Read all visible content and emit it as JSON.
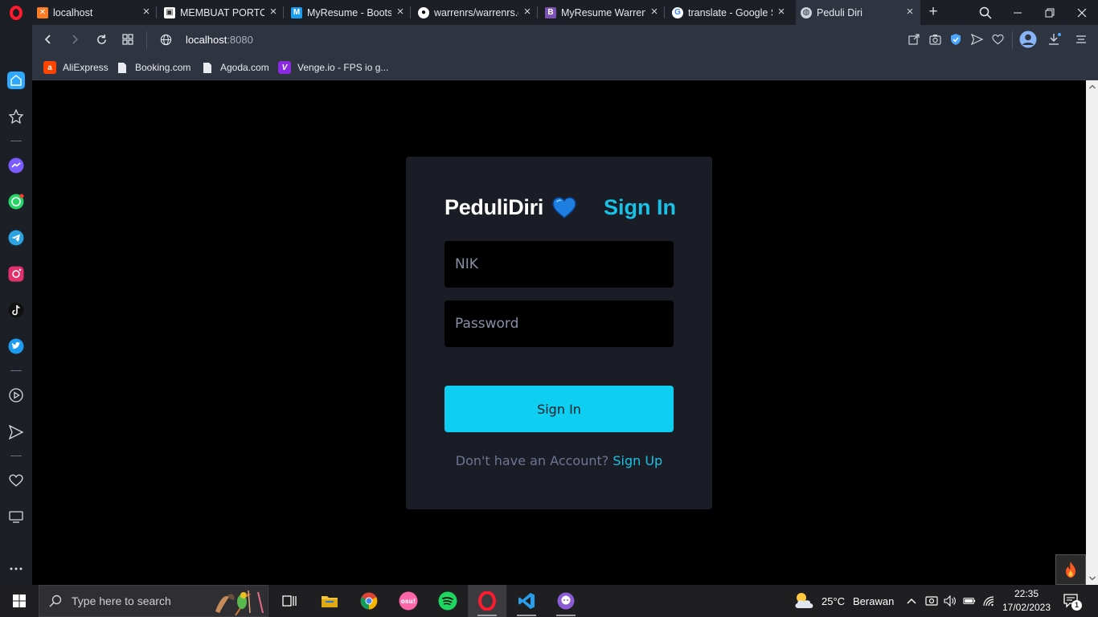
{
  "browser": {
    "tabs": [
      {
        "title": "localhost",
        "favicon": "xampp-icon",
        "active": false
      },
      {
        "title": "MEMBUAT PORTOFOLIO",
        "favicon": "portfolio-icon",
        "active": false
      },
      {
        "title": "MyResume - Bootstrap",
        "favicon": "myresume-icon",
        "active": false
      },
      {
        "title": "warrenrs/warrenrs.github",
        "favicon": "github-icon",
        "active": false
      },
      {
        "title": "MyResume Warren",
        "favicon": "bootstrap-icon",
        "active": false
      },
      {
        "title": "translate - Google Search",
        "favicon": "google-icon",
        "active": false
      },
      {
        "title": "Peduli Diri",
        "favicon": "globe-icon",
        "active": true
      }
    ],
    "address": {
      "host": "localhost",
      "port": ":8080"
    },
    "bookmarks": [
      {
        "label": "AliExpress",
        "icon": "aliexpress-icon"
      },
      {
        "label": "Booking.com",
        "icon": "page-icon"
      },
      {
        "label": "Agoda.com",
        "icon": "page-icon"
      },
      {
        "label": "Venge.io - FPS io g...",
        "icon": "venge-icon"
      }
    ]
  },
  "page": {
    "brand": "PeduliDiri",
    "brand_icon": "blue-heart-icon",
    "title": "Sign In",
    "nik_placeholder": "NIK",
    "password_placeholder": "Password",
    "submit_label": "Sign In",
    "signup_prompt": "Don't have an Account?",
    "signup_link": "Sign Up"
  },
  "taskbar": {
    "search_placeholder": "Type here to search",
    "weather_temp": "25°C",
    "weather_desc": "Berawan",
    "time": "22:35",
    "date": "17/02/2023",
    "notification_count": "1"
  },
  "colors": {
    "accent": "#18c2e7",
    "button": "#0ecff1",
    "card": "#1a1d26",
    "page_bg": "#000000"
  }
}
